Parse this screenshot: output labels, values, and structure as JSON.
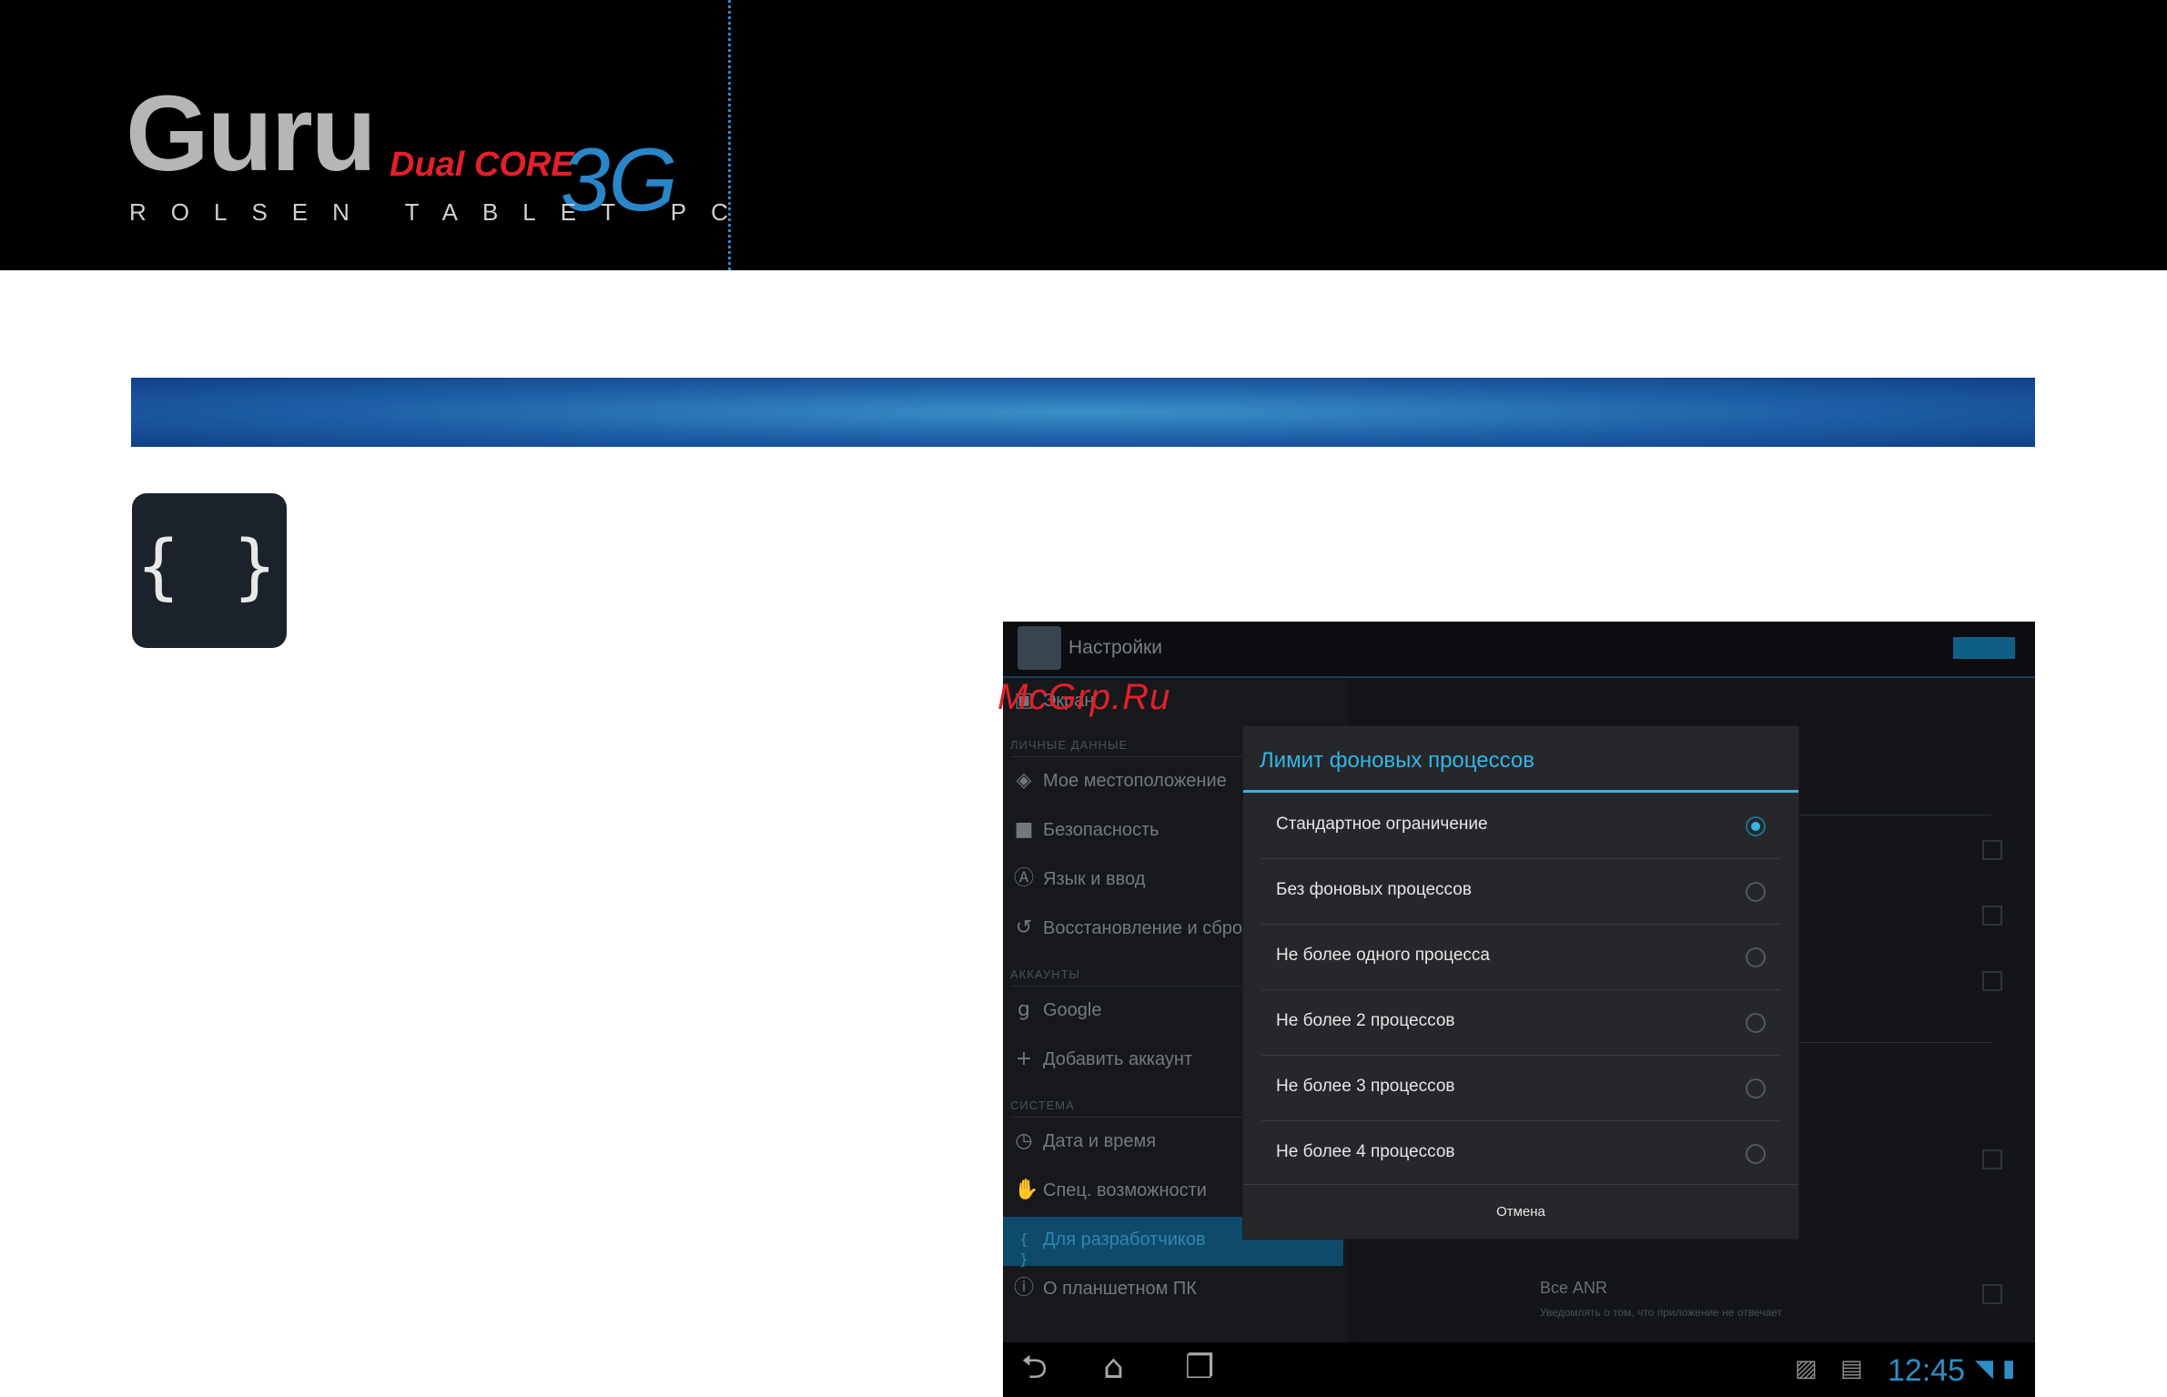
{
  "header": {
    "brand": "Guru",
    "edition": "Dual CORE",
    "network": "3G",
    "subtitle": "ROLSEN TABLET PC"
  },
  "developer_icon": {
    "glyph": "{ }",
    "icon": "braces-icon"
  },
  "screenshot": {
    "action_bar": {
      "title": "Настройки"
    },
    "left_menu": {
      "top_item": "Экран",
      "sections": [
        {
          "title": "ЛИЧНЫЕ ДАННЫЕ",
          "items": [
            "Мое местоположение",
            "Безопасность",
            "Язык и ввод",
            "Восстановление и сброс"
          ]
        },
        {
          "title": "АККАУНТЫ",
          "items": [
            "Google",
            "Добавить аккаунт"
          ]
        },
        {
          "title": "СИСТЕМА",
          "items": [
            "Дата и время",
            "Спец. возможности",
            "Для разработчиков",
            "О планшетном ПК"
          ]
        }
      ],
      "selected": "Для разработчиков"
    },
    "right_panel": {
      "anr_title": "Все ANR",
      "anr_subtitle": "Уведомлять о том, что приложение не отвечает"
    },
    "dialog": {
      "title": "Лимит фоновых процессов",
      "options": [
        "Стандартное ограничение",
        "Без фоновых процессов",
        "Не более одного процесса",
        "Не более 2 процессов",
        "Не более 3 процессов",
        "Не более 4 процессов"
      ],
      "selected_index": 0,
      "cancel": "Отмена"
    },
    "status_bar": {
      "time": "12:45"
    }
  },
  "watermark": "McGrp.Ru",
  "colors": {
    "accent": "#33b5e5",
    "brand_red": "#e3202a",
    "brand_blue": "#2a86c8"
  }
}
